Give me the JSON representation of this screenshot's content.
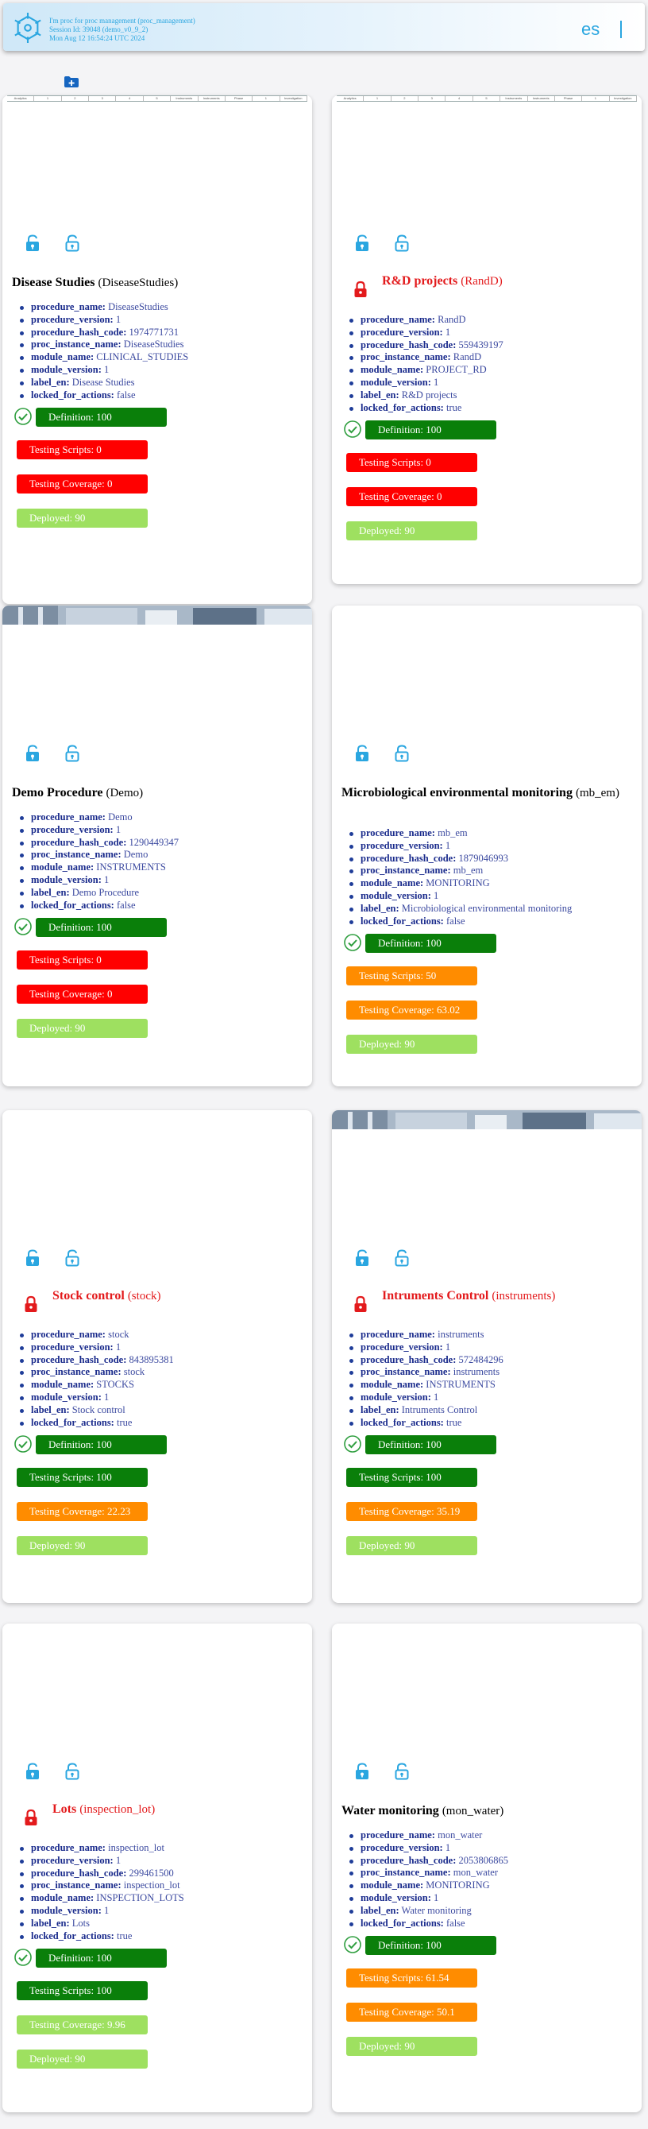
{
  "header": {
    "session_line1": "I'm proc for proc management (proc_management)",
    "session_line2": "Session Id: 39048 (demo_v0_9_2)",
    "session_line3": "Mon Aug 12 16:54:24 UTC 2024",
    "language": "es"
  },
  "toolbar": {
    "add_icon": "folder-plus-icon"
  },
  "mini_table_headers": [
    "Analytics",
    "1",
    "2",
    "3",
    "4",
    "5",
    "Instruments",
    "Instruments",
    "Phase",
    "1",
    "Investigation"
  ],
  "cards": [
    {
      "title": "Disease Studies",
      "code": "(DiseaseStudies)",
      "props": [
        [
          "procedure_name:",
          "DiseaseStudies"
        ],
        [
          "procedure_version:",
          "1"
        ],
        [
          "procedure_hash_code:",
          "1974771731"
        ],
        [
          "proc_instance_name:",
          "DiseaseStudies"
        ],
        [
          "module_name:",
          "CLINICAL_STUDIES"
        ],
        [
          "module_version:",
          "1"
        ],
        [
          "label_en:",
          "Disease Studies"
        ],
        [
          "locked_for_actions:",
          "false"
        ]
      ],
      "definition": "Definition: 100",
      "scripts": "Testing Scripts: 0",
      "coverage": "Testing Coverage: 0",
      "deployed": "Deployed: 90"
    },
    {
      "title": "R&D projects",
      "code": "(RandD)",
      "props": [
        [
          "procedure_name:",
          "RandD"
        ],
        [
          "procedure_version:",
          "1"
        ],
        [
          "procedure_hash_code:",
          "559439197"
        ],
        [
          "proc_instance_name:",
          "RandD"
        ],
        [
          "module_name:",
          "PROJECT_RD"
        ],
        [
          "module_version:",
          "1"
        ],
        [
          "label_en:",
          "R&D projects"
        ],
        [
          "locked_for_actions:",
          "true"
        ]
      ],
      "definition": "Definition: 100",
      "scripts": "Testing Scripts: 0",
      "coverage": "Testing Coverage: 0",
      "deployed": "Deployed: 90"
    },
    {
      "title": "Demo Procedure",
      "code": "(Demo)",
      "props": [
        [
          "procedure_name:",
          "Demo"
        ],
        [
          "procedure_version:",
          "1"
        ],
        [
          "procedure_hash_code:",
          "1290449347"
        ],
        [
          "proc_instance_name:",
          "Demo"
        ],
        [
          "module_name:",
          "INSTRUMENTS"
        ],
        [
          "module_version:",
          "1"
        ],
        [
          "label_en:",
          "Demo Procedure"
        ],
        [
          "locked_for_actions:",
          "false"
        ]
      ],
      "definition": "Definition: 100",
      "scripts": "Testing Scripts: 0",
      "coverage": "Testing Coverage: 0",
      "deployed": "Deployed: 90"
    },
    {
      "title": "Microbiological environmental monitoring",
      "code": "(mb_em)",
      "props": [
        [
          "procedure_name:",
          "mb_em"
        ],
        [
          "procedure_version:",
          "1"
        ],
        [
          "procedure_hash_code:",
          "1879046993"
        ],
        [
          "proc_instance_name:",
          "mb_em"
        ],
        [
          "module_name:",
          "MONITORING"
        ],
        [
          "module_version:",
          "1"
        ],
        [
          "label_en:",
          "Microbiological environmental monitoring"
        ],
        [
          "locked_for_actions:",
          "false"
        ]
      ],
      "definition": "Definition: 100",
      "scripts": "Testing Scripts: 50",
      "coverage": "Testing Coverage: 63.02",
      "deployed": "Deployed: 90"
    },
    {
      "title": "Stock control",
      "code": "(stock)",
      "props": [
        [
          "procedure_name:",
          "stock"
        ],
        [
          "procedure_version:",
          "1"
        ],
        [
          "procedure_hash_code:",
          "843895381"
        ],
        [
          "proc_instance_name:",
          "stock"
        ],
        [
          "module_name:",
          "STOCKS"
        ],
        [
          "module_version:",
          "1"
        ],
        [
          "label_en:",
          "Stock control"
        ],
        [
          "locked_for_actions:",
          "true"
        ]
      ],
      "definition": "Definition: 100",
      "scripts": "Testing Scripts: 100",
      "coverage": "Testing Coverage: 22.23",
      "deployed": "Deployed: 90"
    },
    {
      "title": "Intruments Control",
      "code": "(instruments)",
      "props": [
        [
          "procedure_name:",
          "instruments"
        ],
        [
          "procedure_version:",
          "1"
        ],
        [
          "procedure_hash_code:",
          "572484296"
        ],
        [
          "proc_instance_name:",
          "instruments"
        ],
        [
          "module_name:",
          "INSTRUMENTS"
        ],
        [
          "module_version:",
          "1"
        ],
        [
          "label_en:",
          "Intruments Control"
        ],
        [
          "locked_for_actions:",
          "true"
        ]
      ],
      "definition": "Definition: 100",
      "scripts": "Testing Scripts: 100",
      "coverage": "Testing Coverage: 35.19",
      "deployed": "Deployed: 90"
    },
    {
      "title": "Lots",
      "code": "(inspection_lot)",
      "props": [
        [
          "procedure_name:",
          "inspection_lot"
        ],
        [
          "procedure_version:",
          "1"
        ],
        [
          "procedure_hash_code:",
          "299461500"
        ],
        [
          "proc_instance_name:",
          "inspection_lot"
        ],
        [
          "module_name:",
          "INSPECTION_LOTS"
        ],
        [
          "module_version:",
          "1"
        ],
        [
          "label_en:",
          "Lots"
        ],
        [
          "locked_for_actions:",
          "true"
        ]
      ],
      "definition": "Definition: 100",
      "scripts": "Testing Scripts: 100",
      "coverage": "Testing Coverage: 9.96",
      "deployed": "Deployed: 90"
    },
    {
      "title": "Water monitoring",
      "code": "(mon_water)",
      "props": [
        [
          "procedure_name:",
          "mon_water"
        ],
        [
          "procedure_version:",
          "1"
        ],
        [
          "procedure_hash_code:",
          "2053806865"
        ],
        [
          "proc_instance_name:",
          "mon_water"
        ],
        [
          "module_name:",
          "MONITORING"
        ],
        [
          "module_version:",
          "1"
        ],
        [
          "label_en:",
          "Water monitoring"
        ],
        [
          "locked_for_actions:",
          "false"
        ]
      ],
      "definition": "Definition: 100",
      "scripts": "Testing Scripts: 61.54",
      "coverage": "Testing Coverage: 50.1",
      "deployed": "Deployed: 90"
    }
  ],
  "colors": {
    "accent": "#2aa6e0",
    "ok": "#0a7f0a",
    "fail": "#ff0000",
    "partial": "#ff8c00",
    "deployed": "#9ee060",
    "locked_title": "#e31a1c"
  }
}
